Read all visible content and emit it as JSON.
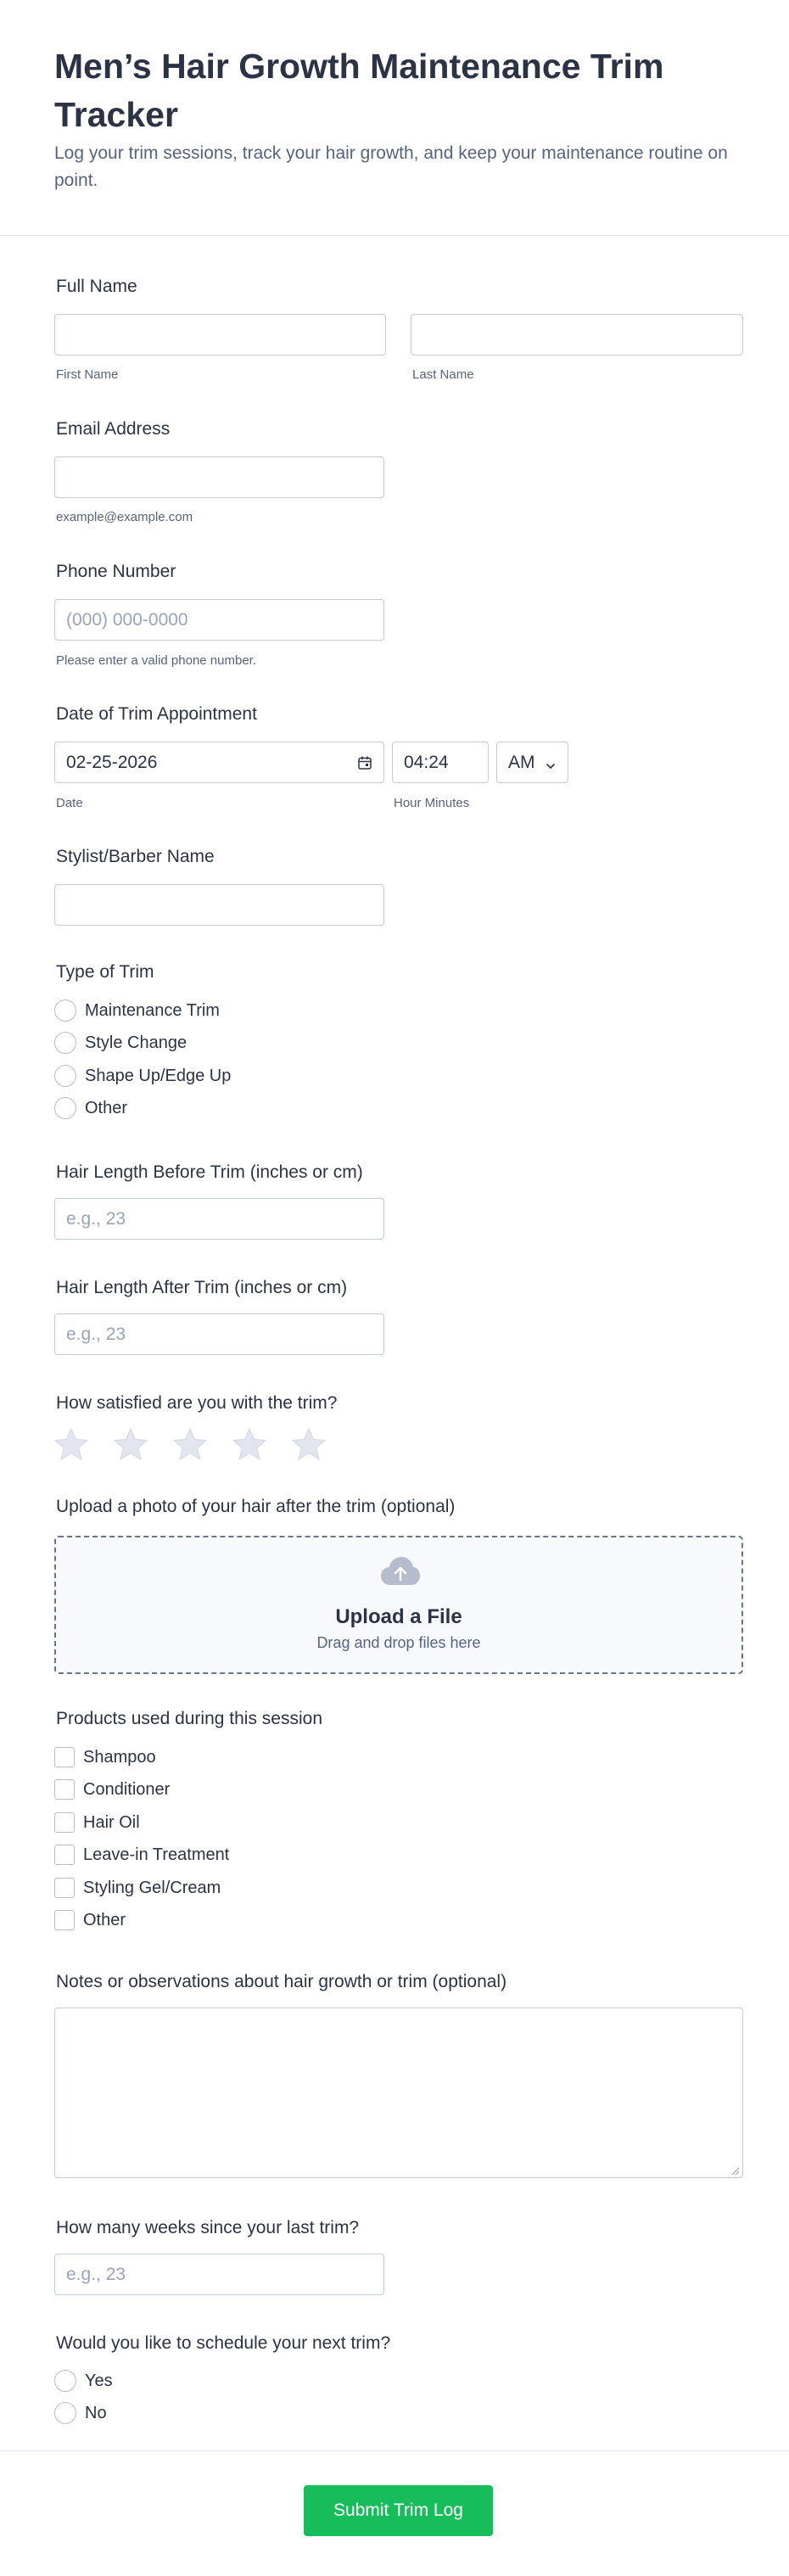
{
  "header": {
    "title": "Men’s Hair Growth Maintenance Trim Tracker",
    "subtitle": "Log your trim sessions, track your hair growth, and keep your maintenance routine on point."
  },
  "full_name": {
    "label": "Full Name",
    "first_value": "",
    "first_sublabel": "First Name",
    "last_value": "",
    "last_sublabel": "Last Name"
  },
  "email": {
    "label": "Email Address",
    "value": "",
    "sublabel": "example@example.com"
  },
  "phone": {
    "label": "Phone Number",
    "placeholder": "(000) 000-0000",
    "sublabel": "Please enter a valid phone number."
  },
  "appointment": {
    "label": "Date of Trim Appointment",
    "date_value": "02-25-2026",
    "date_sublabel": "Date",
    "time_value": "04:24",
    "time_sublabel": "Hour Minutes",
    "ampm_value": "AM"
  },
  "stylist": {
    "label": "Stylist/Barber Name",
    "value": ""
  },
  "trim_type": {
    "label": "Type of Trim",
    "options": [
      "Maintenance Trim",
      "Style Change",
      "Shape Up/Edge Up",
      "Other"
    ]
  },
  "length_before": {
    "label": "Hair Length Before Trim (inches or cm)",
    "placeholder": "e.g., 23"
  },
  "length_after": {
    "label": "Hair Length After Trim (inches or cm)",
    "placeholder": "e.g., 23"
  },
  "satisfaction": {
    "label": "How satisfied are you with the trim?",
    "max_stars": 5,
    "selected": 0
  },
  "upload": {
    "label": "Upload a photo of your hair after the trim (optional)",
    "title": "Upload a File",
    "subtitle": "Drag and drop files here",
    "icon": "cloud-upload-icon"
  },
  "products": {
    "label": "Products used during this session",
    "options": [
      "Shampoo",
      "Conditioner",
      "Hair Oil",
      "Leave-in Treatment",
      "Styling Gel/Cream",
      "Other"
    ]
  },
  "notes": {
    "label": "Notes or observations about hair growth or trim (optional)",
    "value": ""
  },
  "weeks": {
    "label": "How many weeks since your last trim?",
    "placeholder": "e.g., 23"
  },
  "schedule": {
    "label": "Would you like to schedule your next trim?",
    "options": [
      "Yes",
      "No"
    ]
  },
  "submit": {
    "label": "Submit Trim Log",
    "color": "#18bd5b"
  },
  "colors": {
    "text": "#2c3345",
    "muted": "#57647e",
    "border": "#c3cad8",
    "star": "#e4e6ef"
  }
}
